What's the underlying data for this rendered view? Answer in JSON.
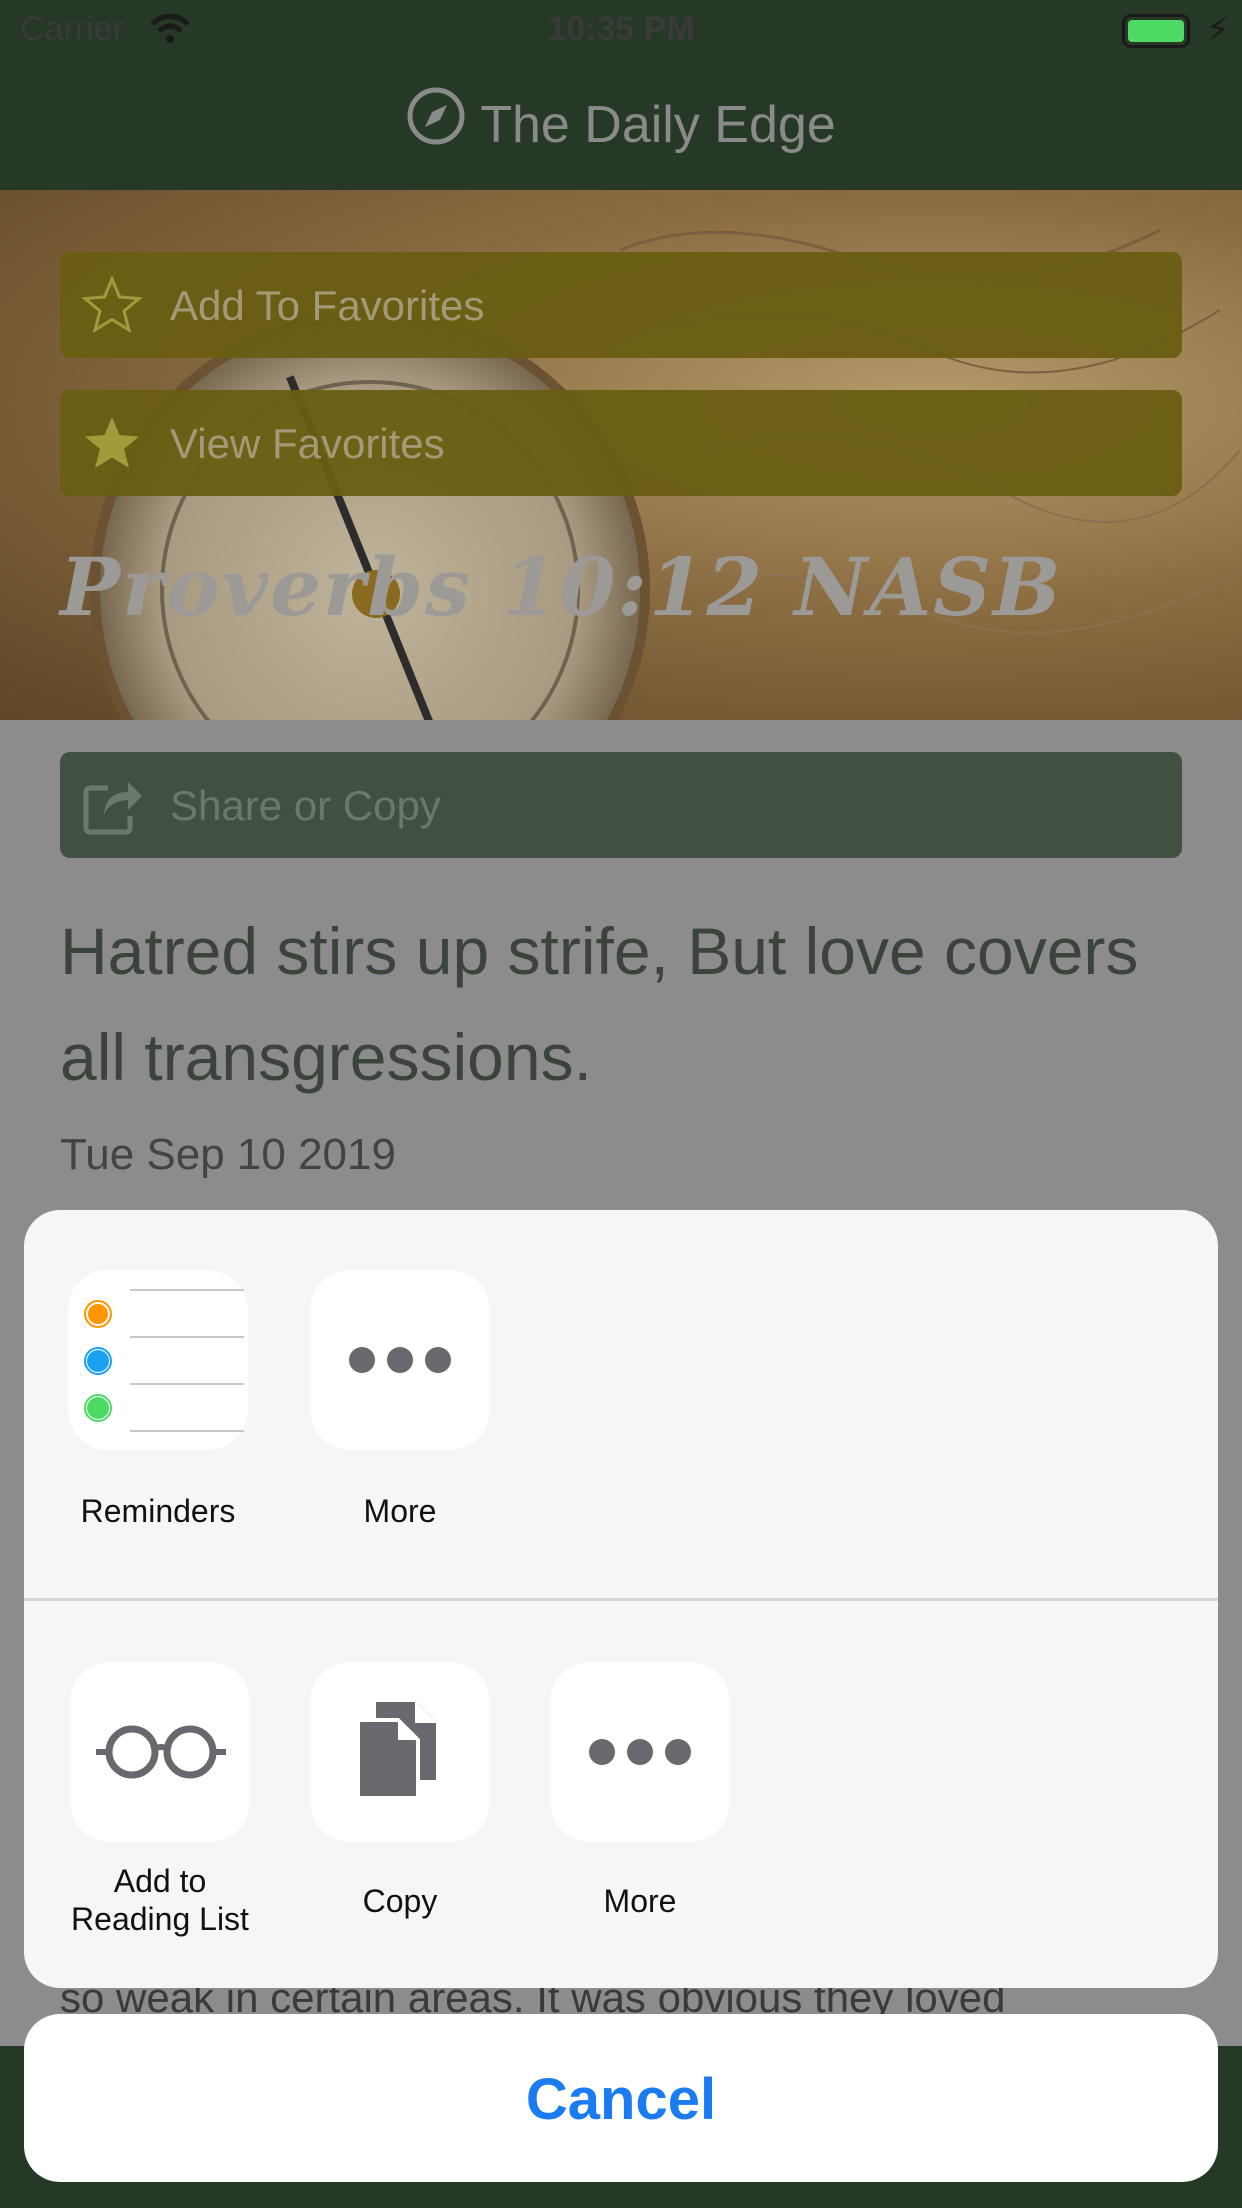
{
  "status_bar": {
    "carrier": "Carrier",
    "time": "10:35 PM"
  },
  "nav": {
    "title": "The Daily Edge"
  },
  "hero": {
    "add_favorites_label": "Add To Favorites",
    "view_favorites_label": "View Favorites",
    "verse_reference": "Proverbs 10:12 NASB"
  },
  "share_button": {
    "label": "Share or Copy"
  },
  "verse": {
    "text": "Hatred stirs up strife, But love covers all transgressions.",
    "date": "Tue Sep 10 2019"
  },
  "body_peek": "so weak in certain areas. It was obvious they loved",
  "share_sheet": {
    "row1": [
      {
        "label": "Reminders",
        "icon": "reminders-icon"
      },
      {
        "label": "More",
        "icon": "more-icon"
      }
    ],
    "row2": [
      {
        "label": "Add to\nReading List",
        "icon": "glasses-icon"
      },
      {
        "label": "Copy",
        "icon": "copy-icon"
      },
      {
        "label": "More",
        "icon": "more-icon"
      }
    ],
    "cancel_label": "Cancel"
  },
  "colors": {
    "bar_green": "#263826",
    "favorites_olive": "#695e12",
    "share_green": "#425042",
    "ios_blue": "#1b7cf2"
  }
}
